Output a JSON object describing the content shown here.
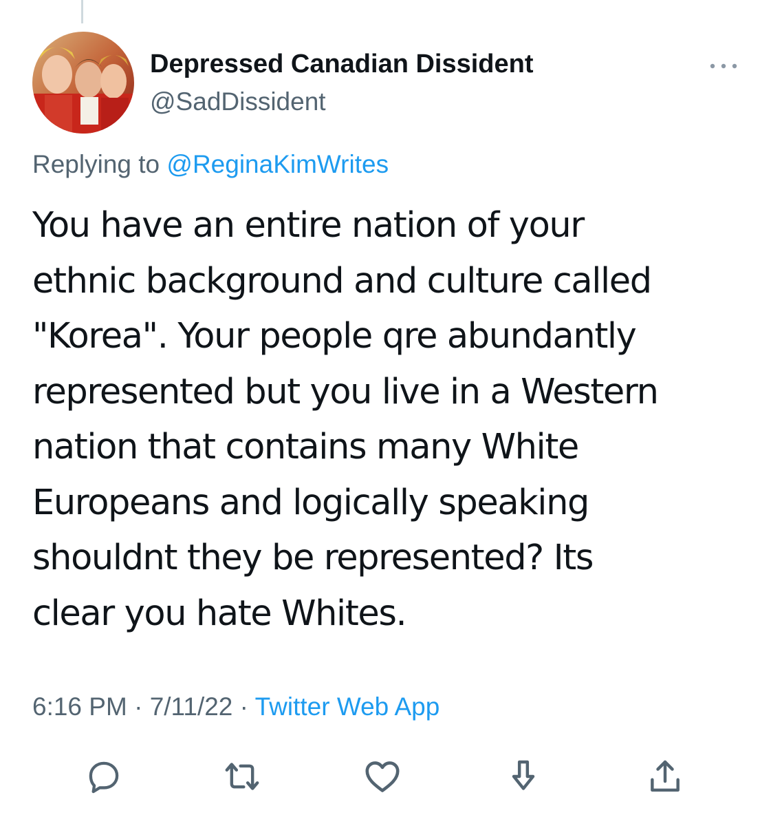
{
  "author": {
    "display_name": "Depressed Canadian Dissident",
    "handle": "@SadDissident"
  },
  "reply": {
    "prefix": "Replying to ",
    "mention": "@ReginaKimWrites"
  },
  "tweet": {
    "text": "You have an entire nation of your\nethnic background and culture called\n\"Korea\". Your people qre abundantly\nrepresented but you live in a Western\nnation that contains many White\nEuropeans and logically speaking\nshouldnt they be represented? Its\nclear you hate Whites."
  },
  "meta": {
    "time": "6:16 PM",
    "date": "7/11/22",
    "separator": " · ",
    "source": "Twitter Web App"
  },
  "actions": [
    {
      "icon": "reply-icon"
    },
    {
      "icon": "retweet-icon"
    },
    {
      "icon": "like-icon"
    },
    {
      "icon": "bookmark-icon"
    },
    {
      "icon": "share-icon"
    }
  ],
  "colors": {
    "text": "#0f1419",
    "secondary": "#536471",
    "link": "#1d9bf0",
    "icon": "#536471"
  }
}
